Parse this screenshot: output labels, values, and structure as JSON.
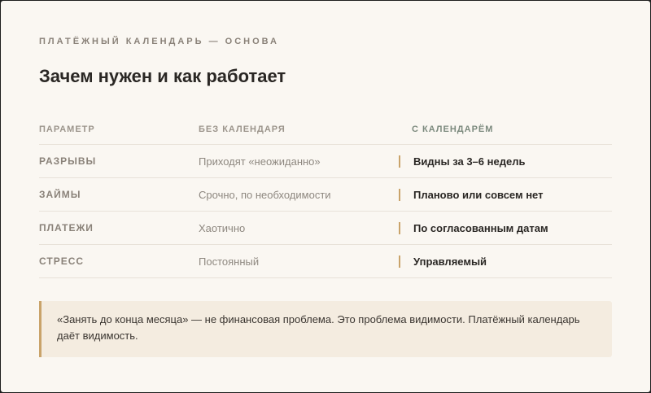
{
  "header": {
    "eyebrow": "ПЛАТЁЖНЫЙ КАЛЕНДАРЬ — ОСНОВА",
    "title": "Зачем нужен и как работает"
  },
  "table": {
    "columns": [
      "ПАРАМЕТР",
      "БЕЗ КАЛЕНДАРЯ",
      "С КАЛЕНДАРЁМ"
    ],
    "rows": [
      {
        "param": "РАЗРЫВЫ",
        "without": "Приходят «неожиданно»",
        "with": "Видны за 3–6 недель"
      },
      {
        "param": "ЗАЙМЫ",
        "without": "Срочно, по необходимости",
        "with": "Планово или совсем нет"
      },
      {
        "param": "ПЛАТЕЖИ",
        "without": "Хаотично",
        "with": "По согласованным датам"
      },
      {
        "param": "СТРЕСС",
        "without": "Постоянный",
        "with": "Управляемый"
      }
    ]
  },
  "note": {
    "text": "«Занять до конца месяца» — не финансовая проблема. Это проблема видимости. Платёжный календарь даёт видимость."
  },
  "colors": {
    "background": "#faf7f2",
    "accent": "#c9a36a",
    "note_background": "#f4ece0",
    "text_dark": "#2a2724",
    "text_muted": "#8e8880",
    "header_accent": "#7c8a7e"
  }
}
